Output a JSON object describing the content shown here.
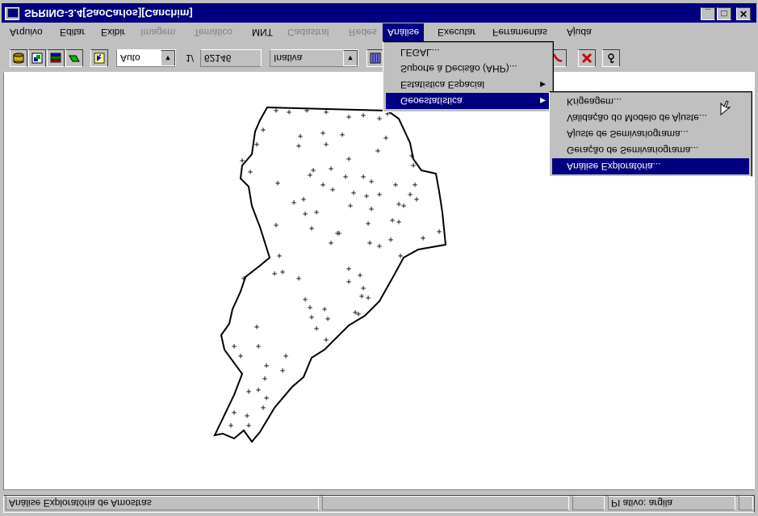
{
  "window": {
    "title": "SPRING-3.4[SaoCarlos][Canchim]",
    "min_glyph": "_",
    "max_glyph": "□",
    "close_glyph": "✕"
  },
  "menubar": {
    "items": [
      {
        "label": "Arquivo",
        "enabled": true
      },
      {
        "label": "Editar",
        "enabled": true
      },
      {
        "label": "Exibir",
        "enabled": true
      },
      {
        "label": "Imagem",
        "enabled": false
      },
      {
        "label": "Temático",
        "enabled": false
      },
      {
        "label": "MNT",
        "enabled": true
      },
      {
        "label": "Cadastral",
        "enabled": false
      },
      {
        "label": "Redes",
        "enabled": false
      },
      {
        "label": "Análise",
        "enabled": true,
        "active": true
      },
      {
        "label": "Executar",
        "enabled": true
      },
      {
        "label": "Ferramentas",
        "enabled": true
      },
      {
        "label": "Ajuda",
        "enabled": true
      }
    ]
  },
  "toolbar": {
    "zoom_mode": "Auto",
    "scale_prefix": "1/",
    "scale_value": "62146",
    "drawing_mode": "Inativa",
    "icons": [
      "database-icon",
      "project-icon",
      "layers-icon",
      "plane-icon",
      "cursor-info-icon",
      "display-icon",
      "pan-icon",
      "delete-icon",
      "query-icon"
    ],
    "accent_red": "#d00000"
  },
  "analysis_menu": {
    "items": [
      {
        "label": "Geoestatística",
        "submenu": true,
        "highlighted": true
      },
      {
        "label": "Estatística Espacial",
        "submenu": true,
        "highlighted": false
      },
      {
        "label": "Suporte à Decisão (AHP)...",
        "submenu": false,
        "highlighted": false
      },
      {
        "label": "LEGAL...",
        "submenu": false,
        "highlighted": false
      }
    ]
  },
  "geostat_submenu": {
    "items": [
      {
        "label": "Análise Exploratória...",
        "highlighted": true
      },
      {
        "label": "Geração de Semivariograma...",
        "highlighted": false
      },
      {
        "label": "Ajuste de Semivariograma...",
        "highlighted": false
      },
      {
        "label": "Validação do Modelo de Ajuste...",
        "highlighted": false
      },
      {
        "label": "Krigeagem...",
        "highlighted": false
      }
    ]
  },
  "statusbar": {
    "message": "Análise Exploratória de Amostras",
    "active_plane": "PI ativo: argila"
  },
  "map": {
    "sample_marker": "+",
    "boundary_color": "#000000",
    "sample_count": 96
  },
  "colors": {
    "titlebar": "#000080",
    "face": "#c0c0c0",
    "highlight": "#000080",
    "canvas": "#ffffff"
  }
}
